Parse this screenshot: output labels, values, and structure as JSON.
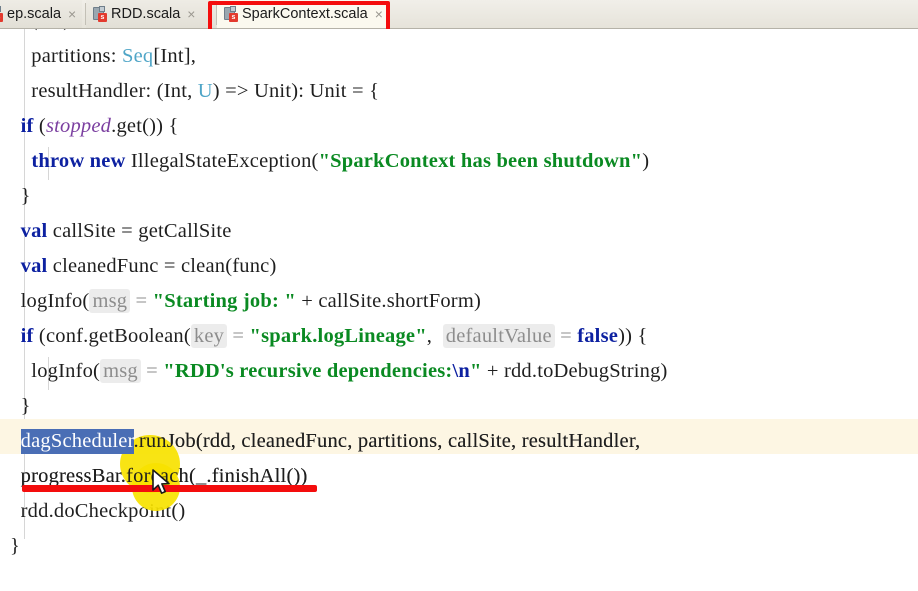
{
  "window": {
    "app": "IntelliJ IDEA editor",
    "active_file": "SparkContext.scala"
  },
  "tabs": [
    {
      "label": "ep.scala",
      "icon": "scala-file-icon",
      "active": false,
      "truncated": true,
      "close_glyph": "×"
    },
    {
      "label": "RDD.scala",
      "icon": "scala-file-icon",
      "active": false,
      "truncated": false,
      "close_glyph": "×"
    },
    {
      "label": "SparkContext.scala",
      "icon": "scala-file-icon",
      "active": true,
      "truncated": false,
      "close_glyph": "×"
    }
  ],
  "annotations": {
    "tab_box_color": "#f40d0d",
    "underline_color": "#f40d0d",
    "blob_color": "#f7e200",
    "selection_color": "#4a6eb5",
    "current_line_color": "#fdf6e3"
  },
  "editor": {
    "language": "scala",
    "partial_top_line": "      (,   ,)      ,",
    "selected_text": "dagScheduler",
    "cursor_line_text": "dagScheduler.runJob(rdd, cleanedFunc, partitions, callSite, resultHandler,",
    "lines": [
      {
        "n": 1,
        "tokens": [
          {
            "t": "    partitions: ",
            "c": "plain"
          },
          {
            "t": "Seq",
            "c": "typ"
          },
          {
            "t": "[Int],",
            "c": "plain"
          }
        ]
      },
      {
        "n": 2,
        "tokens": [
          {
            "t": "    resultHandler: (Int, ",
            "c": "plain"
          },
          {
            "t": "U",
            "c": "typ"
          },
          {
            "t": ") => Unit): Unit = {",
            "c": "plain"
          }
        ]
      },
      {
        "n": 3,
        "tokens": [
          {
            "t": "  ",
            "c": "plain"
          },
          {
            "t": "if",
            "c": "kw"
          },
          {
            "t": " (",
            "c": "plain"
          },
          {
            "t": "stopped",
            "c": "fld"
          },
          {
            "t": ".get()) {",
            "c": "plain"
          }
        ]
      },
      {
        "n": 4,
        "tokens": [
          {
            "t": "    ",
            "c": "plain"
          },
          {
            "t": "throw new",
            "c": "kw"
          },
          {
            "t": " IllegalStateException(",
            "c": "plain"
          },
          {
            "t": "\"SparkContext has been shutdown\"",
            "c": "str"
          },
          {
            "t": ")",
            "c": "plain"
          }
        ]
      },
      {
        "n": 5,
        "tokens": [
          {
            "t": "  }",
            "c": "plain"
          }
        ]
      },
      {
        "n": 6,
        "tokens": [
          {
            "t": "  ",
            "c": "plain"
          },
          {
            "t": "val",
            "c": "kw"
          },
          {
            "t": " callSite = getCallSite",
            "c": "plain"
          }
        ]
      },
      {
        "n": 7,
        "tokens": [
          {
            "t": "  ",
            "c": "plain"
          },
          {
            "t": "val",
            "c": "kw"
          },
          {
            "t": " cleanedFunc = clean(func)",
            "c": "plain"
          }
        ]
      },
      {
        "n": 8,
        "tokens": [
          {
            "t": "  logInfo(",
            "c": "plain"
          },
          {
            "t": "msg",
            "c": "hint"
          },
          {
            "t": " = ",
            "c": "hinteq"
          },
          {
            "t": "\"Starting job: \"",
            "c": "str"
          },
          {
            "t": " + callSite.shortForm)",
            "c": "plain"
          }
        ]
      },
      {
        "n": 9,
        "tokens": [
          {
            "t": "  ",
            "c": "plain"
          },
          {
            "t": "if",
            "c": "kw"
          },
          {
            "t": " (conf.getBoolean(",
            "c": "plain"
          },
          {
            "t": "key",
            "c": "hint"
          },
          {
            "t": " = ",
            "c": "hinteq"
          },
          {
            "t": "\"spark.logLineage\"",
            "c": "str"
          },
          {
            "t": ",  ",
            "c": "plain"
          },
          {
            "t": "defaultValue",
            "c": "hint"
          },
          {
            "t": " = ",
            "c": "hinteq"
          },
          {
            "t": "false",
            "c": "kw"
          },
          {
            "t": ")) {",
            "c": "plain"
          }
        ]
      },
      {
        "n": 10,
        "tokens": [
          {
            "t": "    logInfo(",
            "c": "plain"
          },
          {
            "t": "msg",
            "c": "hint"
          },
          {
            "t": " = ",
            "c": "hinteq"
          },
          {
            "t": "\"RDD's recursive dependencies:",
            "c": "str"
          },
          {
            "t": "\\n",
            "c": "esc"
          },
          {
            "t": "\"",
            "c": "str"
          },
          {
            "t": " + rdd.toDebugString)",
            "c": "plain"
          }
        ]
      },
      {
        "n": 11,
        "tokens": [
          {
            "t": "  }",
            "c": "plain"
          }
        ]
      },
      {
        "n": 12,
        "highlighted": true,
        "tokens": [
          {
            "t": "  ",
            "c": "plain"
          },
          {
            "t": "dagScheduler",
            "c": "sel"
          },
          {
            "t": ".runJob(rdd, cleanedFunc, partitions, callSite, resultHandler,",
            "c": "plain"
          }
        ]
      },
      {
        "n": 13,
        "tokens": [
          {
            "t": "  progressBar.foreach(_.finishAll())",
            "c": "plain"
          }
        ]
      },
      {
        "n": 14,
        "tokens": [
          {
            "t": "  rdd.doCheckpoint()",
            "c": "plain"
          }
        ]
      },
      {
        "n": 15,
        "tokens": [
          {
            "t": "}",
            "c": "plain"
          }
        ]
      }
    ]
  }
}
